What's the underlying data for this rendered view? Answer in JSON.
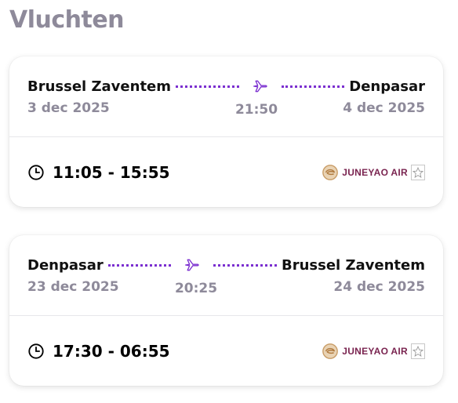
{
  "section": {
    "title": "Vluchten"
  },
  "flights": [
    {
      "origin": "Brussel Zaventem",
      "destination": "Denpasar",
      "depart_date": "3 dec 2025",
      "arrive_date": "4 dec 2025",
      "duration": "21:50",
      "times": "11:05 - 15:55",
      "airline": "JUNEYAO AIR"
    },
    {
      "origin": "Denpasar",
      "destination": "Brussel Zaventem",
      "depart_date": "23 dec 2025",
      "arrive_date": "24 dec 2025",
      "duration": "20:25",
      "times": "17:30 - 06:55",
      "airline": "JUNEYAO AIR"
    }
  ],
  "colors": {
    "accent_purple": "#7b2fd0",
    "muted_text": "#8e8a9a",
    "airline_brand": "#7a2450"
  },
  "icons": [
    "plane-icon",
    "clock-icon",
    "juneyao-logo-icon",
    "airline-badge-icon"
  ]
}
